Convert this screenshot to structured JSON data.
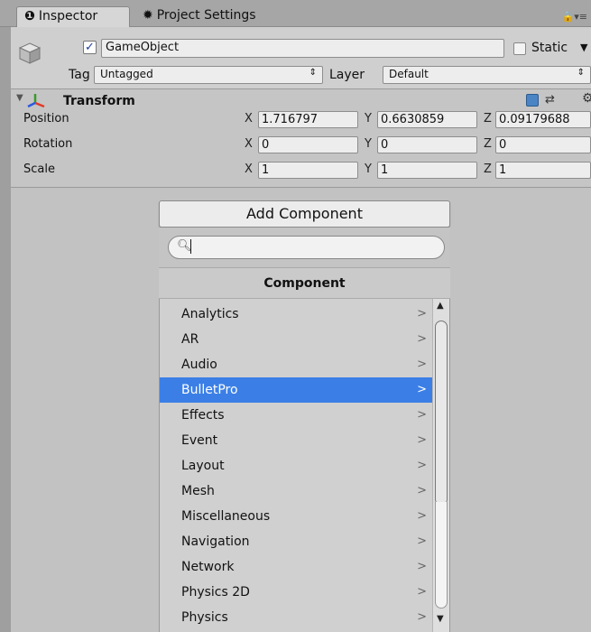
{
  "tabs": {
    "inspector": {
      "icon": "info-icon",
      "glyph": "❶",
      "label": "Inspector"
    },
    "project_settings": {
      "icon": "gear-icon",
      "glyph": "✹",
      "label": "Project Settings"
    },
    "menu_glyph": "🔒▾≡"
  },
  "object": {
    "active_checked": true,
    "name": "GameObject",
    "static_label": "Static",
    "static_checked": false,
    "tag_label": "Tag",
    "tag_value": "Untagged",
    "layer_label": "Layer",
    "layer_value": "Default"
  },
  "transform": {
    "title": "Transform",
    "rows": [
      {
        "label": "Position",
        "x": "1.716797",
        "y": "0.6630859",
        "z": "0.09179688"
      },
      {
        "label": "Rotation",
        "x": "0",
        "y": "0",
        "z": "0"
      },
      {
        "label": "Scale",
        "x": "1",
        "y": "1",
        "z": "1"
      }
    ],
    "axis_labels": {
      "x": "X",
      "y": "Y",
      "z": "Z"
    }
  },
  "add_component": {
    "button_label": "Add Component",
    "search_value": "",
    "header": "Component",
    "chevron": ">",
    "items": [
      {
        "label": "Analytics",
        "selected": false
      },
      {
        "label": "AR",
        "selected": false
      },
      {
        "label": "Audio",
        "selected": false
      },
      {
        "label": "BulletPro",
        "selected": true
      },
      {
        "label": "Effects",
        "selected": false
      },
      {
        "label": "Event",
        "selected": false
      },
      {
        "label": "Layout",
        "selected": false
      },
      {
        "label": "Mesh",
        "selected": false
      },
      {
        "label": "Miscellaneous",
        "selected": false
      },
      {
        "label": "Navigation",
        "selected": false
      },
      {
        "label": "Network",
        "selected": false
      },
      {
        "label": "Physics 2D",
        "selected": false
      },
      {
        "label": "Physics",
        "selected": false
      }
    ]
  },
  "colors": {
    "selection": "#3b7fe6",
    "panel": "#c2c2c2",
    "field": "#ededed"
  }
}
